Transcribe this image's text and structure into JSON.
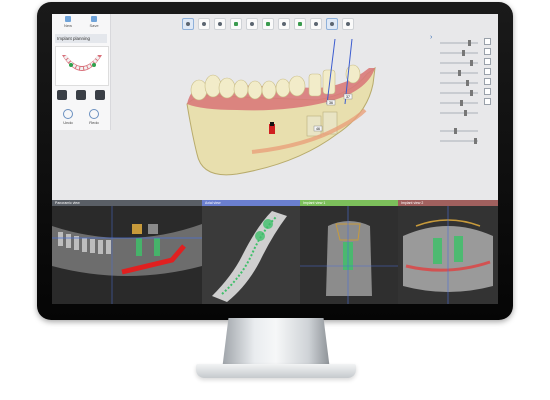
{
  "left_panel": {
    "top_buttons": [
      "New",
      "Save"
    ],
    "title": "Implant planning",
    "buttons": [
      "Undo",
      "Redo"
    ]
  },
  "toolbar": {
    "icons": [
      "patient-icon",
      "scan-icon",
      "wrench-icon",
      "jaw-icon",
      "implant-icon",
      "crown-icon",
      "guide-icon",
      "sleeve-icon",
      "bone-icon",
      "tooth-icon",
      "settings-icon"
    ]
  },
  "implant_labels": [
    "46",
    "36",
    "37"
  ],
  "right_panel": {
    "chevron": "›"
  },
  "views": [
    {
      "title": "Panoramic view",
      "color": "#5a5f66"
    },
    {
      "title": "Axial view",
      "color": "#6b7fcf"
    },
    {
      "title": "Implant view 1",
      "color": "#7cbf5b"
    },
    {
      "title": "Implant view 2",
      "color": "#a0605e"
    }
  ],
  "colors": {
    "accent": "#3b6fb6",
    "model": "#e8dfae",
    "gum": "#d97a7a",
    "nerve": "#e04040",
    "implant": "#3fbf6a"
  }
}
